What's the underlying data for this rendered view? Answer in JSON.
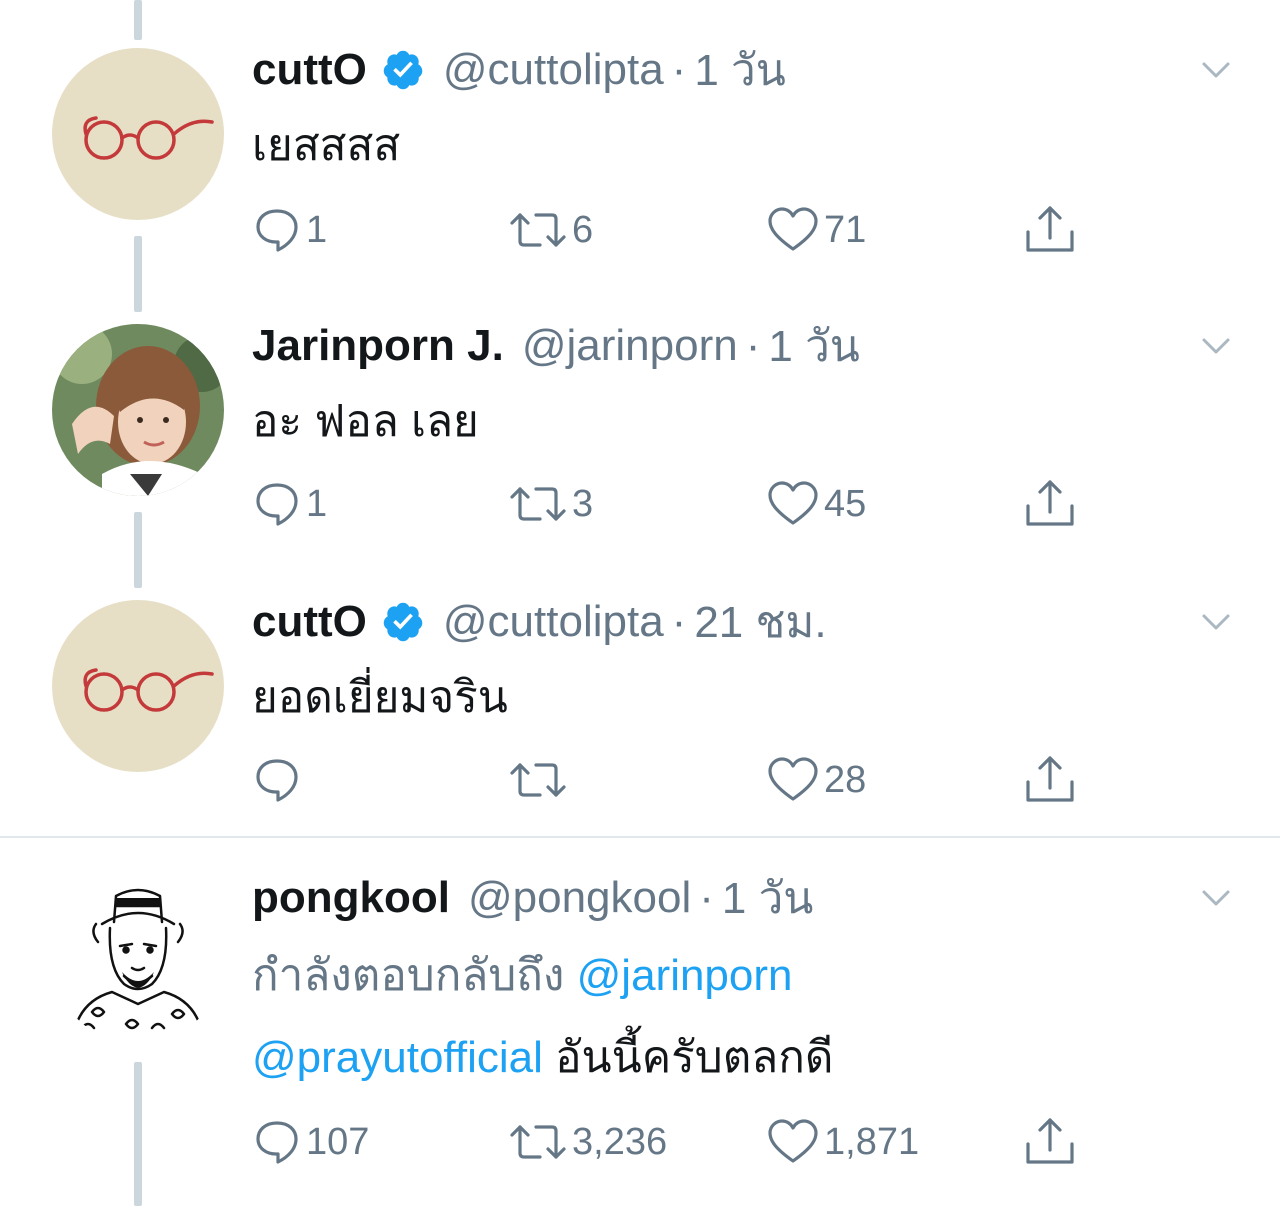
{
  "tweets": [
    {
      "display_name": "cuttO",
      "verified": true,
      "handle": "@cuttolipta",
      "separator": "·",
      "time": "1 วัน",
      "text": "เยสสสส",
      "actions": {
        "reply": "1",
        "retweet": "6",
        "like": "71"
      },
      "avatar_icon": "glasses-avatar"
    },
    {
      "display_name": "Jarinporn J.",
      "verified": false,
      "handle": "@jarinporn",
      "separator": "·",
      "time": "1 วัน",
      "text": "อะ ฟอล เลย",
      "actions": {
        "reply": "1",
        "retweet": "3",
        "like": "45"
      },
      "avatar_icon": "photo-avatar"
    },
    {
      "display_name": "cuttO",
      "verified": true,
      "handle": "@cuttolipta",
      "separator": "·",
      "time": "21 ชม.",
      "text": "ยอดเยี่ยมจริน",
      "actions": {
        "reply": "",
        "retweet": "",
        "like": "28"
      },
      "avatar_icon": "glasses-avatar"
    },
    {
      "display_name": "pongkool",
      "verified": false,
      "handle": "@pongkool",
      "separator": "·",
      "time": "1 วัน",
      "reply_prefix": "กำลังตอบกลับถึง",
      "mention_1": "@jarinporn",
      "mention_2": "@prayutofficial",
      "text": "อันนี้ครับตลกดี",
      "actions": {
        "reply": "107",
        "retweet": "3,236",
        "like": "1,871"
      },
      "avatar_icon": "sketch-avatar"
    }
  ],
  "colors": {
    "text": "#14171a",
    "muted": "#657786",
    "link": "#1da1f2",
    "thread_line": "#ccd6dd",
    "divider": "#e1e8ed",
    "verified": "#1da1f2"
  }
}
